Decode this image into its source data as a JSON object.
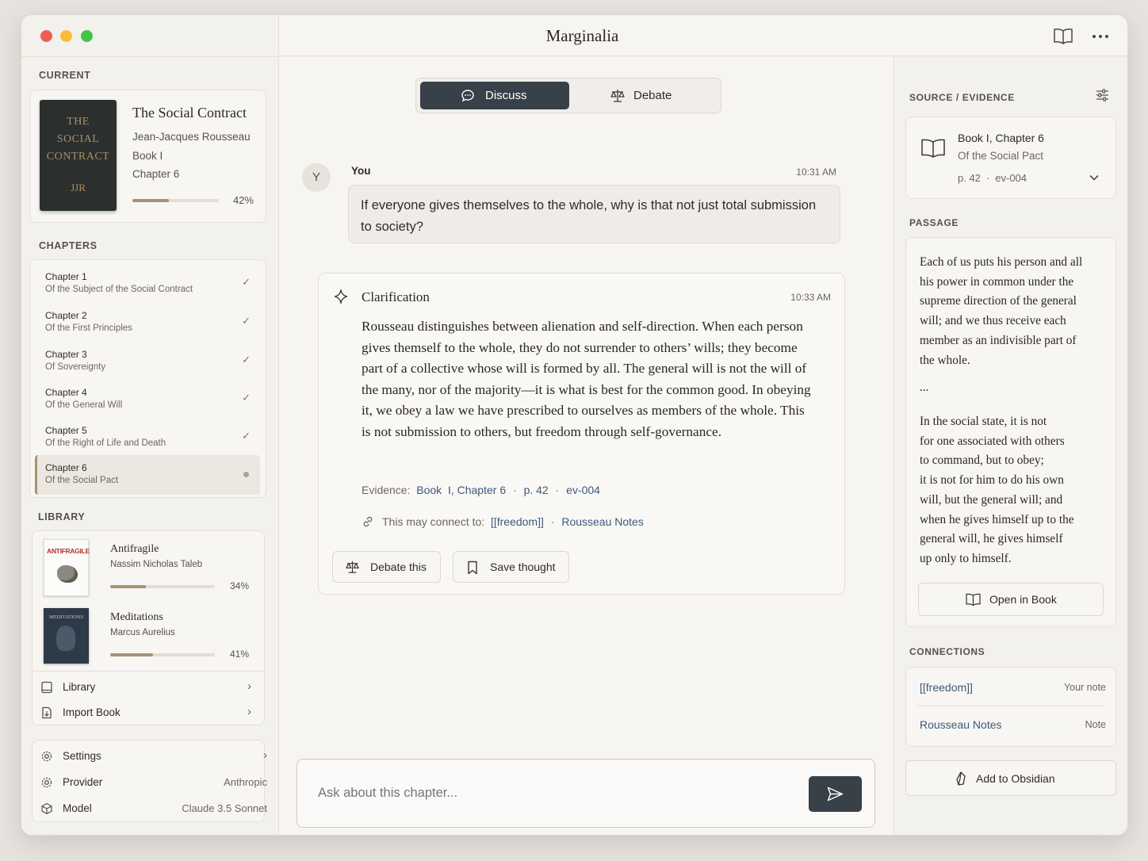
{
  "app_title": "Marginalia",
  "sidebar": {
    "current_heading": "CURRENT",
    "current_book": {
      "cover_lines": [
        "THE",
        "SOCIAL",
        "CONTRACT"
      ],
      "cover_initials": "JJR",
      "title": "The Social Contract",
      "author": "Jean-Jacques Rousseau",
      "book": "Book I",
      "chapter": "Chapter 6",
      "progress_label": "42%",
      "progress": 0.42
    },
    "chapters_heading": "CHAPTERS",
    "chapters": [
      {
        "title": "Chapter 1",
        "subtitle": "Of the Subject of the Social Contract",
        "done": true
      },
      {
        "title": "Chapter 2",
        "subtitle": "Of the First Principles",
        "done": true
      },
      {
        "title": "Chapter 3",
        "subtitle": "Of Sovereignty",
        "done": true
      },
      {
        "title": "Chapter 4",
        "subtitle": "Of the General Will",
        "done": true
      },
      {
        "title": "Chapter 5",
        "subtitle": "Of the Right of Life and Death",
        "done": true
      },
      {
        "title": "Chapter 6",
        "subtitle": "Of the Social Pact",
        "done": false,
        "active": true
      }
    ],
    "library_heading": "LIBRARY",
    "library": [
      {
        "title": "Antifragile",
        "author": "Nassim Nicholas Taleb",
        "progress_label": "34%",
        "progress": 0.34,
        "cover_text": "ANTIFRAGILE"
      },
      {
        "title": "Meditations",
        "author": "Marcus Aurelius",
        "progress_label": "41%",
        "progress": 0.41,
        "cover_text": "MEDITATIONS"
      }
    ],
    "library_link": "Library",
    "import_link": "Import Book",
    "settings_label": "Settings",
    "provider_label": "Provider",
    "provider_value": "Anthropic",
    "model_label": "Model",
    "model_value": "Claude 3.5 Sonnet"
  },
  "tabs": {
    "discuss": "Discuss",
    "debate": "Debate",
    "active": "discuss"
  },
  "chat": {
    "user_avatar": "Y",
    "user_name": "You",
    "user_time": "10:31 AM",
    "user_message": "If everyone gives themselves to the whole, why is that not just total submission to society?",
    "reply_title": "Clarification",
    "reply_time": "10:33 AM",
    "reply_text": "Rousseau distinguishes between alienation and self-direction. When each person gives themself to the whole, they do not surrender to others’ wills; they become part of a collective whose will is formed by all. The general will is not the will of the many, nor of the majority—it is what is best for the common good. In obeying it, we obey a law we have prescribed to ourselves as members of the whole. This is not submission to others, but freedom through self-governance.",
    "evidence_label": "Evidence:",
    "evidence_chapter": "Book  I, Chapter 6",
    "evidence_page": "p. 42",
    "evidence_id": "ev-004",
    "connect_label": "This may connect to:",
    "connect_note": "[[freedom]]",
    "connect_notes": "Rousseau Notes",
    "debate_button": "Debate this",
    "save_button": "Save thought",
    "input_placeholder": "Ask about this chapter..."
  },
  "right": {
    "source_heading": "SOURCE / EVIDENCE",
    "source_title": "Book I, Chapter 6",
    "source_subtitle": "Of the Social Pact",
    "source_page": "p. 42",
    "source_dot": "·",
    "source_id": "ev-004",
    "passage_heading": "PASSAGE",
    "passage_lines_1": [
      "Each of us puts his person and all",
      "his power in common under the",
      "supreme direction of the general",
      "will; and we thus receive each",
      "member as an indivisible part of",
      "the whole."
    ],
    "passage_ellipsis": "...",
    "passage_lines_2": [
      "In the social state, it is not",
      "for one associated with others",
      "to command, but to obey;",
      "it is not for him to do his own",
      "will, but the general will; and",
      "when he gives himself up to the",
      "general will, he gives himself",
      "up only to himself."
    ],
    "open_button": "Open in Book",
    "connections_heading": "CONNECTIONS",
    "connections": [
      {
        "name": "[[freedom]]",
        "type": "Your note"
      },
      {
        "name": "Rousseau Notes",
        "type": "Note"
      }
    ],
    "obsidian_button": "Add to Obsidian"
  },
  "colors": {
    "accent": "#384048",
    "link": "#3d5a7a",
    "progress": "#a89273"
  }
}
